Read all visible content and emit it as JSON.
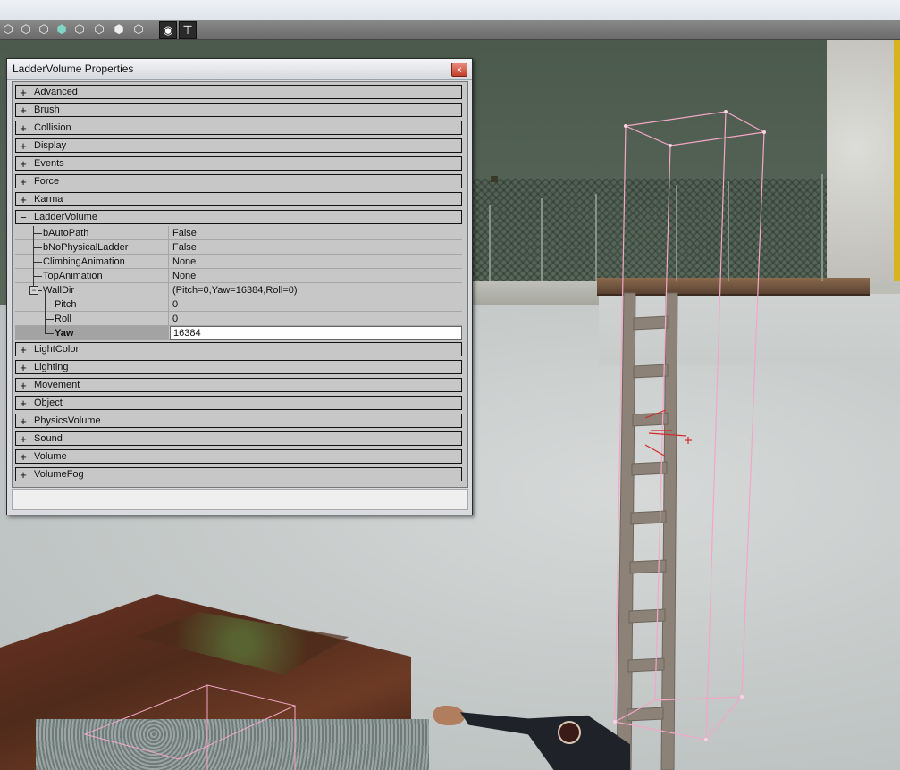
{
  "toolbar": {
    "icons": [
      "cube-icon",
      "cube-icon",
      "cube-icon",
      "cube-icon",
      "cube-icon",
      "cube-icon",
      "cube-icon",
      "cube-icon",
      "eye-icon",
      "pin-icon"
    ]
  },
  "window": {
    "title": "LadderVolume Properties",
    "close_glyph": "x",
    "categories_top": [
      {
        "label": "Advanced",
        "toggle": "+"
      },
      {
        "label": "Brush",
        "toggle": "+"
      },
      {
        "label": "Collision",
        "toggle": "+"
      },
      {
        "label": "Display",
        "toggle": "+"
      },
      {
        "label": "Events",
        "toggle": "+"
      },
      {
        "label": "Force",
        "toggle": "+"
      },
      {
        "label": "Karma",
        "toggle": "+"
      },
      {
        "label": "LadderVolume",
        "toggle": "−"
      }
    ],
    "properties": [
      {
        "name": "bAutoPath",
        "value": "False"
      },
      {
        "name": "bNoPhysicalLadder",
        "value": "False"
      },
      {
        "name": "ClimbingAnimation",
        "value": "None"
      },
      {
        "name": "TopAnimation",
        "value": "None"
      },
      {
        "name": "WallDir",
        "value": "(Pitch=0,Yaw=16384,Roll=0)"
      },
      {
        "name": "Pitch",
        "value": "0"
      },
      {
        "name": "Roll",
        "value": "0"
      },
      {
        "name": "Yaw",
        "value": "16384"
      }
    ],
    "categories_bottom": [
      {
        "label": "LightColor",
        "toggle": "+"
      },
      {
        "label": "Lighting",
        "toggle": "+"
      },
      {
        "label": "Movement",
        "toggle": "+"
      },
      {
        "label": "Object",
        "toggle": "+"
      },
      {
        "label": "PhysicsVolume",
        "toggle": "+"
      },
      {
        "label": "Sound",
        "toggle": "+"
      },
      {
        "label": "Volume",
        "toggle": "+"
      },
      {
        "label": "VolumeFog",
        "toggle": "+"
      }
    ]
  },
  "colors": {
    "volume_wireframe": "#f4a6c8",
    "pivot_marker": "#d42a2a"
  }
}
